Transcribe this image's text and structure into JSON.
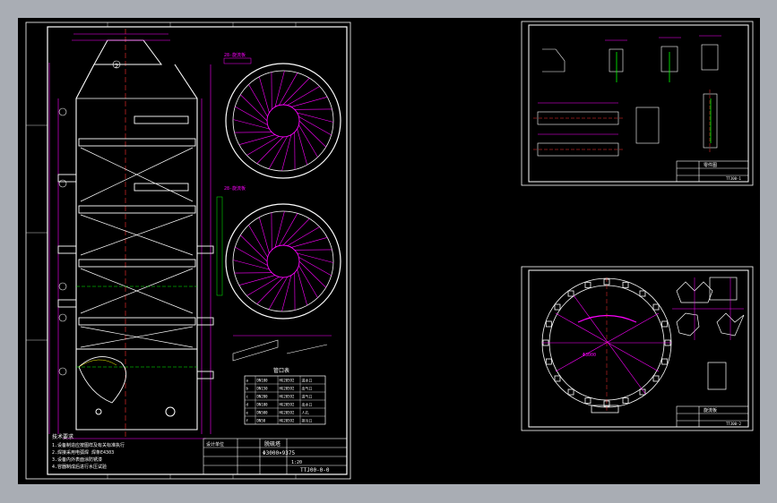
{
  "sheet1": {
    "tag_top": "2",
    "notes_title": "技术要求",
    "notes_lines": [
      "1.设备制造应按图样及有关标准执行",
      "2.焊接采用电弧焊 焊条E4303",
      "3.设备内外表面涂防锈漆",
      "4.容器制成后进行水压试验"
    ],
    "table_title": "管口表",
    "table_rows": [
      [
        "a",
        "DN100",
        "HG20592",
        "进水口"
      ],
      [
        "b",
        "DN150",
        "HG20592",
        "出气口"
      ],
      [
        "c",
        "DN200",
        "HG20592",
        "进气口"
      ],
      [
        "d",
        "DN100",
        "HG20592",
        "出水口"
      ],
      [
        "e",
        "DN500",
        "HG20592",
        "人孔"
      ],
      [
        "f",
        "DN50",
        "HG20592",
        "排污口"
      ]
    ],
    "title_company": "设计单位",
    "title_name": "脱硫塔",
    "title_spec": "Φ3000×9375",
    "drawing_no": "TTJ00-0-0",
    "scale": "1:20",
    "plate_label": "28-旋流板",
    "plate_label2": "28-旋流板"
  },
  "sheet2": {
    "title_name": "零件图",
    "drawing_no": "TTJ00-1"
  },
  "sheet3": {
    "title_name": "旋流板",
    "drawing_no": "TTJ00-2",
    "dim": "Φ3000"
  },
  "colors": {
    "background": "#000000",
    "outer": "#a9adb4",
    "line_white": "#ffffff",
    "line_magenta": "#ff00ff",
    "line_green": "#00ff00",
    "line_red": "#ff3030",
    "line_cyan": "#00ffff",
    "line_yellow": "#ffff00"
  }
}
